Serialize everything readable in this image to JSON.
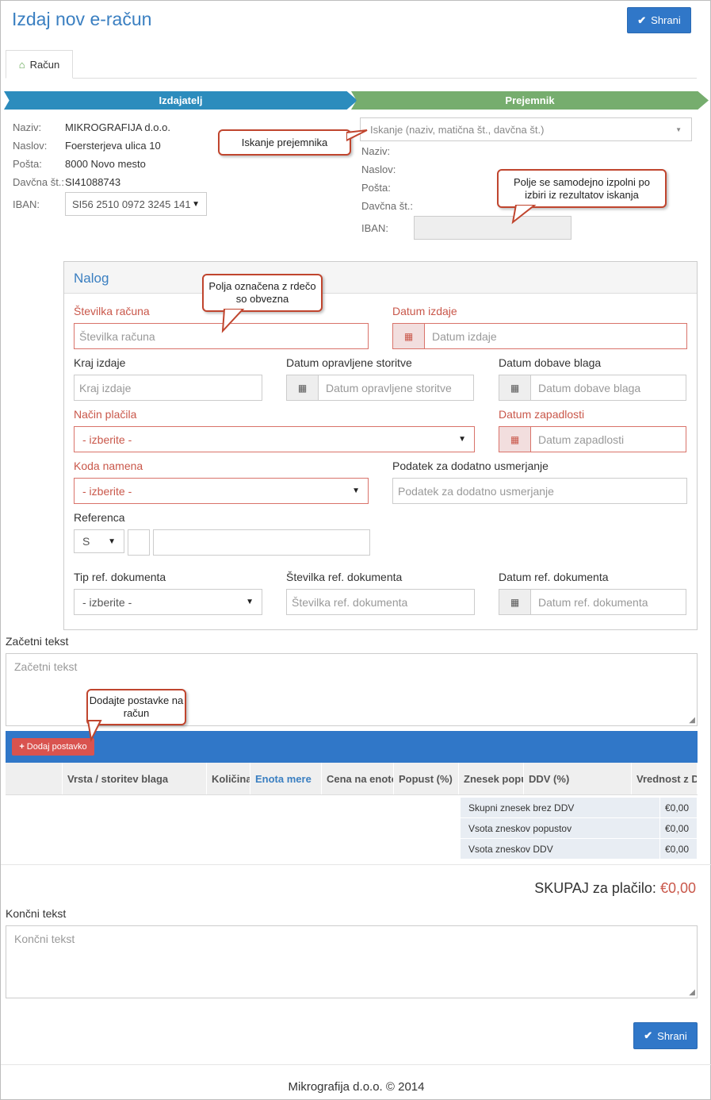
{
  "header": {
    "title": "Izdaj nov e-račun",
    "save_label": "Shrani"
  },
  "tabs": [
    {
      "label": "Račun"
    }
  ],
  "steps": {
    "issuer": "Izdajatelj",
    "recipient": "Prejemnik"
  },
  "issuer": {
    "labels": {
      "name": "Naziv:",
      "address": "Naslov:",
      "post": "Pošta:",
      "tax": "Davčna št.:",
      "iban": "IBAN:"
    },
    "name": "MIKROGRAFIJA d.o.o.",
    "address": "Foersterjeva ulica 10",
    "post": "8000 Novo mesto",
    "tax": "SI41088743",
    "iban": "SI56 2510 0972 3245 141"
  },
  "recipient": {
    "search_placeholder": "Iskanje (naziv, matična št., davčna št.)",
    "labels": {
      "name": "Naziv:",
      "address": "Naslov:",
      "post": "Pošta:",
      "tax": "Davčna št.:",
      "iban": "IBAN:"
    }
  },
  "callouts": {
    "search": "Iskanje prejemnika",
    "autofill": "Polje se samodejno izpolni po izbiri iz rezultatov iskanja",
    "required": "Polja označena z rdečo so obvezna",
    "add_items": "Dodajte postavke na račun"
  },
  "order": {
    "title": "Nalog",
    "invoice_number": {
      "label": "Številka računa",
      "placeholder": "Številka računa"
    },
    "issue_date": {
      "label": "Datum izdaje",
      "placeholder": "Datum izdaje"
    },
    "place": {
      "label": "Kraj izdaje",
      "placeholder": "Kraj izdaje"
    },
    "service_date": {
      "label": "Datum opravljene storitve",
      "placeholder": "Datum opravljene storitve"
    },
    "delivery_date": {
      "label": "Datum dobave blaga",
      "placeholder": "Datum dobave blaga"
    },
    "payment_method": {
      "label": "Način plačila",
      "value": "- izberite -"
    },
    "due_date": {
      "label": "Datum zapadlosti",
      "placeholder": "Datum zapadlosti"
    },
    "purpose_code": {
      "label": "Koda namena",
      "value": "- izberite -"
    },
    "routing": {
      "label": "Podatek za dodatno usmerjanje",
      "placeholder": "Podatek za dodatno usmerjanje"
    },
    "reference": {
      "label": "Referenca",
      "value": "S"
    },
    "ref_doc_type": {
      "label": "Tip ref. dokumenta",
      "value": "- izberite -"
    },
    "ref_doc_number": {
      "label": "Številka ref. dokumenta",
      "placeholder": "Številka ref. dokumenta"
    },
    "ref_doc_date": {
      "label": "Datum ref. dokumenta",
      "placeholder": "Datum ref. dokumenta"
    }
  },
  "intro_text": {
    "label": "Začetni tekst",
    "placeholder": "Začetni tekst"
  },
  "items": {
    "add_label": "Dodaj postavko",
    "columns": [
      "",
      "Vrsta / storitev blaga",
      "Količina",
      "Enota mere",
      "Cena na enoto",
      "Popust (%)",
      "Znesek popusta",
      "DDV (%)",
      "Vrednost z DDV"
    ]
  },
  "summary": [
    {
      "label": "Skupni znesek brez DDV",
      "value": "€0,00"
    },
    {
      "label": "Vsota zneskov popustov",
      "value": "€0,00"
    },
    {
      "label": "Vsota zneskov DDV",
      "value": "€0,00"
    }
  ],
  "total": {
    "label": "SKUPAJ za plačilo:",
    "value": "€0,00"
  },
  "closing_text": {
    "label": "Končni tekst",
    "placeholder": "Končni tekst"
  },
  "footer": "Mikrografija d.o.o. © 2014"
}
